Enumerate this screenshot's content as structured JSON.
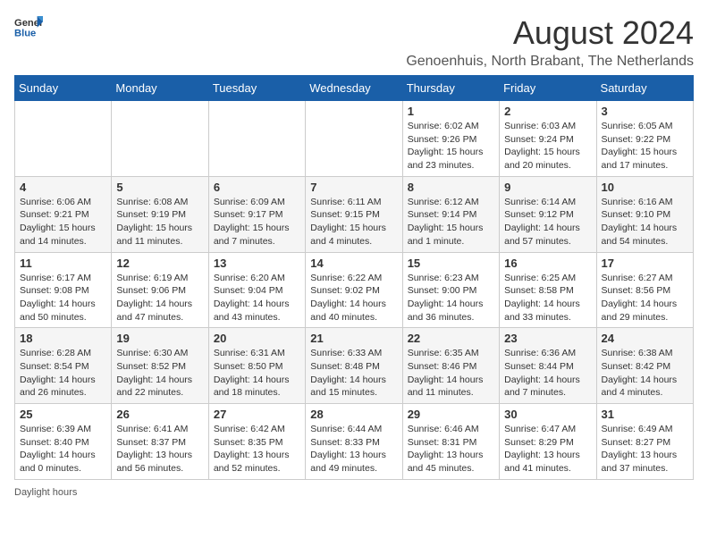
{
  "header": {
    "logo_general": "General",
    "logo_blue": "Blue",
    "title": "August 2024",
    "location": "Genoenhuis, North Brabant, The Netherlands"
  },
  "days_of_week": [
    "Sunday",
    "Monday",
    "Tuesday",
    "Wednesday",
    "Thursday",
    "Friday",
    "Saturday"
  ],
  "weeks": [
    [
      {
        "day": "",
        "info": ""
      },
      {
        "day": "",
        "info": ""
      },
      {
        "day": "",
        "info": ""
      },
      {
        "day": "",
        "info": ""
      },
      {
        "day": "1",
        "info": "Sunrise: 6:02 AM\nSunset: 9:26 PM\nDaylight: 15 hours\nand 23 minutes."
      },
      {
        "day": "2",
        "info": "Sunrise: 6:03 AM\nSunset: 9:24 PM\nDaylight: 15 hours\nand 20 minutes."
      },
      {
        "day": "3",
        "info": "Sunrise: 6:05 AM\nSunset: 9:22 PM\nDaylight: 15 hours\nand 17 minutes."
      }
    ],
    [
      {
        "day": "4",
        "info": "Sunrise: 6:06 AM\nSunset: 9:21 PM\nDaylight: 15 hours\nand 14 minutes."
      },
      {
        "day": "5",
        "info": "Sunrise: 6:08 AM\nSunset: 9:19 PM\nDaylight: 15 hours\nand 11 minutes."
      },
      {
        "day": "6",
        "info": "Sunrise: 6:09 AM\nSunset: 9:17 PM\nDaylight: 15 hours\nand 7 minutes."
      },
      {
        "day": "7",
        "info": "Sunrise: 6:11 AM\nSunset: 9:15 PM\nDaylight: 15 hours\nand 4 minutes."
      },
      {
        "day": "8",
        "info": "Sunrise: 6:12 AM\nSunset: 9:14 PM\nDaylight: 15 hours\nand 1 minute."
      },
      {
        "day": "9",
        "info": "Sunrise: 6:14 AM\nSunset: 9:12 PM\nDaylight: 14 hours\nand 57 minutes."
      },
      {
        "day": "10",
        "info": "Sunrise: 6:16 AM\nSunset: 9:10 PM\nDaylight: 14 hours\nand 54 minutes."
      }
    ],
    [
      {
        "day": "11",
        "info": "Sunrise: 6:17 AM\nSunset: 9:08 PM\nDaylight: 14 hours\nand 50 minutes."
      },
      {
        "day": "12",
        "info": "Sunrise: 6:19 AM\nSunset: 9:06 PM\nDaylight: 14 hours\nand 47 minutes."
      },
      {
        "day": "13",
        "info": "Sunrise: 6:20 AM\nSunset: 9:04 PM\nDaylight: 14 hours\nand 43 minutes."
      },
      {
        "day": "14",
        "info": "Sunrise: 6:22 AM\nSunset: 9:02 PM\nDaylight: 14 hours\nand 40 minutes."
      },
      {
        "day": "15",
        "info": "Sunrise: 6:23 AM\nSunset: 9:00 PM\nDaylight: 14 hours\nand 36 minutes."
      },
      {
        "day": "16",
        "info": "Sunrise: 6:25 AM\nSunset: 8:58 PM\nDaylight: 14 hours\nand 33 minutes."
      },
      {
        "day": "17",
        "info": "Sunrise: 6:27 AM\nSunset: 8:56 PM\nDaylight: 14 hours\nand 29 minutes."
      }
    ],
    [
      {
        "day": "18",
        "info": "Sunrise: 6:28 AM\nSunset: 8:54 PM\nDaylight: 14 hours\nand 26 minutes."
      },
      {
        "day": "19",
        "info": "Sunrise: 6:30 AM\nSunset: 8:52 PM\nDaylight: 14 hours\nand 22 minutes."
      },
      {
        "day": "20",
        "info": "Sunrise: 6:31 AM\nSunset: 8:50 PM\nDaylight: 14 hours\nand 18 minutes."
      },
      {
        "day": "21",
        "info": "Sunrise: 6:33 AM\nSunset: 8:48 PM\nDaylight: 14 hours\nand 15 minutes."
      },
      {
        "day": "22",
        "info": "Sunrise: 6:35 AM\nSunset: 8:46 PM\nDaylight: 14 hours\nand 11 minutes."
      },
      {
        "day": "23",
        "info": "Sunrise: 6:36 AM\nSunset: 8:44 PM\nDaylight: 14 hours\nand 7 minutes."
      },
      {
        "day": "24",
        "info": "Sunrise: 6:38 AM\nSunset: 8:42 PM\nDaylight: 14 hours\nand 4 minutes."
      }
    ],
    [
      {
        "day": "25",
        "info": "Sunrise: 6:39 AM\nSunset: 8:40 PM\nDaylight: 14 hours\nand 0 minutes."
      },
      {
        "day": "26",
        "info": "Sunrise: 6:41 AM\nSunset: 8:37 PM\nDaylight: 13 hours\nand 56 minutes."
      },
      {
        "day": "27",
        "info": "Sunrise: 6:42 AM\nSunset: 8:35 PM\nDaylight: 13 hours\nand 52 minutes."
      },
      {
        "day": "28",
        "info": "Sunrise: 6:44 AM\nSunset: 8:33 PM\nDaylight: 13 hours\nand 49 minutes."
      },
      {
        "day": "29",
        "info": "Sunrise: 6:46 AM\nSunset: 8:31 PM\nDaylight: 13 hours\nand 45 minutes."
      },
      {
        "day": "30",
        "info": "Sunrise: 6:47 AM\nSunset: 8:29 PM\nDaylight: 13 hours\nand 41 minutes."
      },
      {
        "day": "31",
        "info": "Sunrise: 6:49 AM\nSunset: 8:27 PM\nDaylight: 13 hours\nand 37 minutes."
      }
    ]
  ],
  "footer": {
    "note": "Daylight hours"
  }
}
